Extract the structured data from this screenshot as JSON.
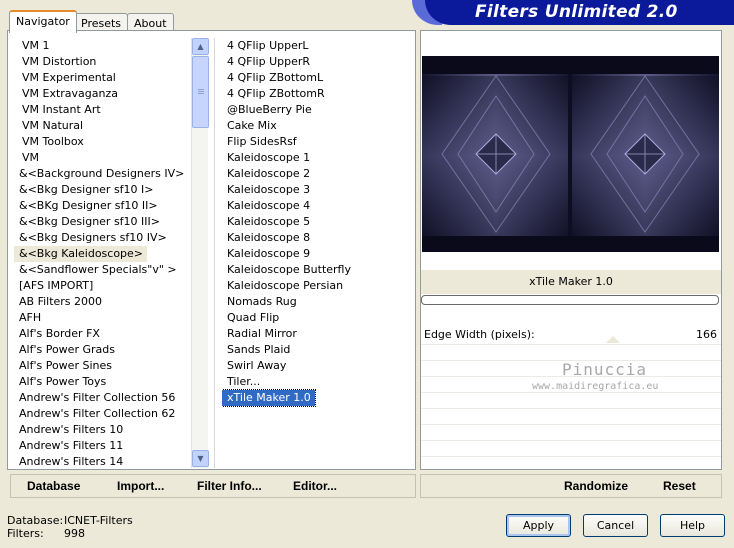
{
  "tabs": [
    {
      "label": "Navigator",
      "active": true
    },
    {
      "label": "Presets",
      "active": false
    },
    {
      "label": "About",
      "active": false
    }
  ],
  "banner": {
    "title": "Filters Unlimited 2.0"
  },
  "categories": [
    "VM 1",
    "VM Distortion",
    "VM Experimental",
    "VM Extravaganza",
    "VM Instant Art",
    "VM Natural",
    "VM Toolbox",
    "VM",
    "&<Background Designers IV>",
    "&<Bkg Designer sf10 I>",
    "&<BKg Designer sf10 II>",
    "&<Bkg Designer sf10 III>",
    "&<Bkg Designers sf10 IV>",
    "&<Bkg Kaleidoscope>",
    "&<Sandflower Specials\"v\" >",
    "[AFS IMPORT]",
    "AB Filters 2000",
    "AFH",
    "Alf's Border FX",
    "Alf's Power Grads",
    "Alf's Power Sines",
    "Alf's Power Toys",
    "Andrew's Filter Collection 56",
    "Andrew's Filter Collection 62",
    "Andrew's Filters 10",
    "Andrew's Filters 11",
    "Andrew's Filters 14"
  ],
  "selected_category": "&<Bkg Kaleidoscope>",
  "filters": [
    "4 QFlip UpperL",
    "4 QFlip UpperR",
    "4 QFlip ZBottomL",
    "4 QFlip ZBottomR",
    "@BlueBerry Pie",
    "Cake Mix",
    "Flip SidesRsf",
    "Kaleidoscope 1",
    "Kaleidoscope 2",
    "Kaleidoscope 3",
    "Kaleidoscope 4",
    "Kaleidoscope 5",
    "Kaleidoscope 8",
    "Kaleidoscope 9",
    "Kaleidoscope Butterfly",
    "Kaleidoscope Persian",
    "Nomads Rug",
    "Quad Flip",
    "Radial Mirror",
    "Sands Plaid",
    "Swirl Away",
    "Tiler...",
    "xTile Maker 1.0"
  ],
  "selected_filter": "xTile Maker 1.0",
  "filter_title": "xTile Maker 1.0",
  "param": {
    "label": "Edge Width (pixels):",
    "value": "166"
  },
  "watermark": {
    "line1": "Pinuccia",
    "line2": "www.maidiregrafica.eu"
  },
  "toolbar": {
    "database": "Database",
    "import": "Import...",
    "filter_info": "Filter Info...",
    "editor": "Editor...",
    "randomize": "Randomize",
    "reset": "Reset"
  },
  "status": {
    "database_label": "Database:",
    "database_value": "ICNET-Filters",
    "filters_label": "Filters:",
    "filters_value": "998"
  },
  "buttons": {
    "apply": "Apply",
    "cancel": "Cancel",
    "help": "Help"
  },
  "preview_colors": {
    "dark": "#1c1c34",
    "mid": "#5a5a8a",
    "light": "#9a9acc"
  }
}
